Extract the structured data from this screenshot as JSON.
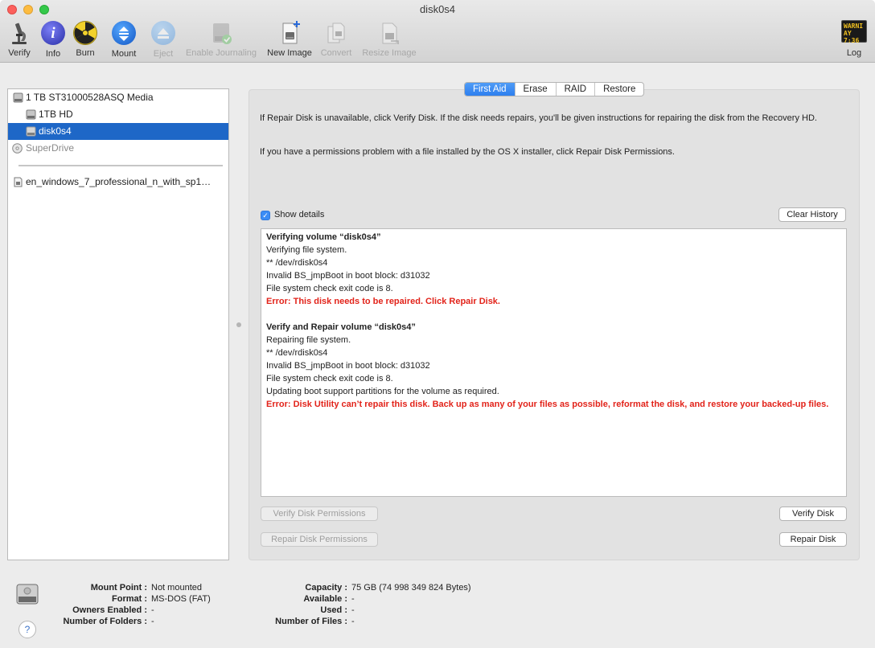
{
  "window": {
    "title": "disk0s4"
  },
  "toolbar": {
    "items": [
      {
        "label": "Verify",
        "icon": "microscope-icon",
        "enabled": true
      },
      {
        "label": "Info",
        "icon": "info-icon",
        "enabled": true
      },
      {
        "label": "Burn",
        "icon": "burn-radiation-icon",
        "enabled": true
      },
      {
        "label": "Mount",
        "icon": "mount-icon",
        "enabled": true
      },
      {
        "label": "Eject",
        "icon": "eject-icon",
        "enabled": false
      },
      {
        "label": "Enable Journaling",
        "icon": "journal-disk-icon",
        "enabled": false
      },
      {
        "label": "New Image",
        "icon": "new-image-icon",
        "enabled": true
      },
      {
        "label": "Convert",
        "icon": "convert-icon",
        "enabled": false
      },
      {
        "label": "Resize Image",
        "icon": "resize-image-icon",
        "enabled": false
      }
    ],
    "log": {
      "label": "Log",
      "badge_line1": "WARNI",
      "badge_line2": "AY 7:36"
    }
  },
  "sidebar": {
    "items": [
      {
        "label": "1 TB ST31000528ASQ Media",
        "icon": "hard-drive-icon",
        "level": 0,
        "selected": false,
        "dimmed": false
      },
      {
        "label": "1TB HD",
        "icon": "volume-icon",
        "level": 1,
        "selected": false,
        "dimmed": false
      },
      {
        "label": "disk0s4",
        "icon": "volume-icon",
        "level": 1,
        "selected": true,
        "dimmed": false
      },
      {
        "label": "SuperDrive",
        "icon": "optical-drive-icon",
        "level": 0,
        "selected": false,
        "dimmed": true
      },
      {
        "label": "en_windows_7_professional_n_with_sp1…",
        "icon": "disk-image-icon",
        "level": 0,
        "selected": false,
        "dimmed": false
      }
    ]
  },
  "tabs": [
    "First Aid",
    "Erase",
    "RAID",
    "Restore"
  ],
  "active_tab": "First Aid",
  "first_aid": {
    "info1": "If Repair Disk is unavailable, click Verify Disk. If the disk needs repairs, you'll be given instructions for repairing the disk from the Recovery HD.",
    "info2": "If you have a permissions problem with a file installed by the OS X installer, click Repair Disk Permissions.",
    "show_details_label": "Show details",
    "show_details_checked": true,
    "clear_history_label": "Clear History",
    "log_lines": [
      {
        "text": "Verifying volume “disk0s4”",
        "style": "b"
      },
      {
        "text": "Verifying file system.",
        "style": ""
      },
      {
        "text": "** /dev/rdisk0s4",
        "style": ""
      },
      {
        "text": "Invalid BS_jmpBoot in boot block: d31032",
        "style": ""
      },
      {
        "text": "File system check exit code is 8.",
        "style": ""
      },
      {
        "text": "Error: This disk needs to be repaired. Click Repair Disk.",
        "style": "err"
      },
      {
        "text": "",
        "style": "gap"
      },
      {
        "text": "Verify and Repair volume “disk0s4”",
        "style": "b"
      },
      {
        "text": "Repairing file system.",
        "style": ""
      },
      {
        "text": "** /dev/rdisk0s4",
        "style": ""
      },
      {
        "text": "Invalid BS_jmpBoot in boot block: d31032",
        "style": ""
      },
      {
        "text": "File system check exit code is 8.",
        "style": ""
      },
      {
        "text": "Updating boot support partitions for the volume as required.",
        "style": ""
      },
      {
        "text": "Error: Disk Utility can’t repair this disk. Back up as many of your files as possible, reformat the disk, and restore your backed-up files.",
        "style": "err"
      }
    ],
    "verify_permissions_label": "Verify Disk Permissions",
    "repair_permissions_label": "Repair Disk Permissions",
    "verify_disk_label": "Verify Disk",
    "repair_disk_label": "Repair Disk"
  },
  "disk_info": {
    "left": [
      {
        "key": "Mount Point :",
        "value": "Not mounted"
      },
      {
        "key": "Format :",
        "value": "MS-DOS (FAT)"
      },
      {
        "key": "Owners Enabled :",
        "value": "-"
      },
      {
        "key": "Number of Folders :",
        "value": "-"
      }
    ],
    "right": [
      {
        "key": "Capacity :",
        "value": "75 GB (74 998 349 824 Bytes)"
      },
      {
        "key": "Available :",
        "value": "-"
      },
      {
        "key": "Used :",
        "value": "-"
      },
      {
        "key": "Number of Files :",
        "value": "-"
      }
    ]
  },
  "help_label": "?",
  "colors": {
    "selection": "#1e67c7",
    "tab_active": "#3b8df5",
    "error": "#e2231a"
  }
}
